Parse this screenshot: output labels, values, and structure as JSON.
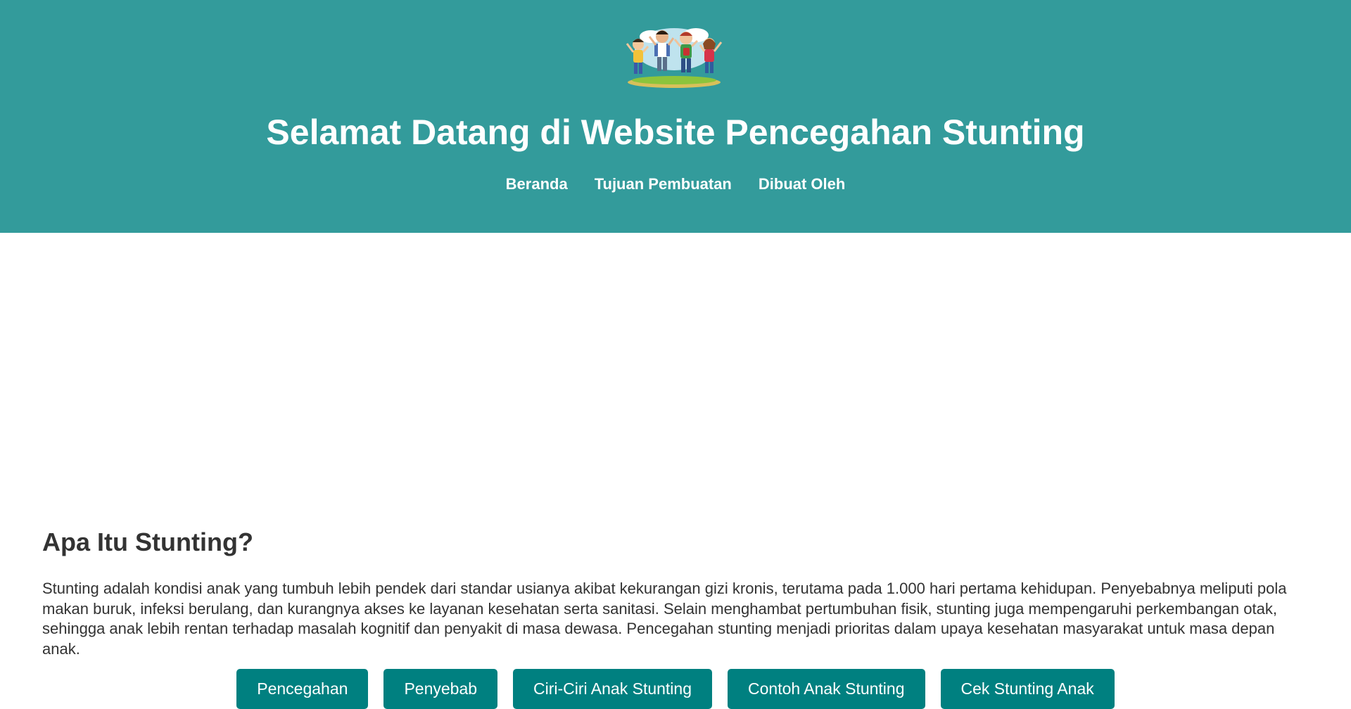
{
  "header": {
    "logo_icon": "jumping-children-illustration",
    "title": "Selamat Datang di Website Pencegahan Stunting",
    "nav": [
      {
        "label": "Beranda"
      },
      {
        "label": "Tujuan Pembuatan"
      },
      {
        "label": "Dibuat Oleh"
      }
    ]
  },
  "main": {
    "heading": "Apa Itu Stunting?",
    "paragraph": "Stunting adalah kondisi anak yang tumbuh lebih pendek dari standar usianya akibat kekurangan gizi kronis, terutama pada 1.000 hari pertama kehidupan. Penyebabnya meliputi pola makan buruk, infeksi berulang, dan kurangnya akses ke layanan kesehatan serta sanitasi. Selain menghambat pertumbuhan fisik, stunting juga mempengaruhi perkembangan otak, sehingga anak lebih rentan terhadap masalah kognitif dan penyakit di masa dewasa. Pencegahan stunting menjadi prioritas dalam upaya kesehatan masyarakat untuk masa depan anak.",
    "buttons": [
      {
        "label": "Pencegahan"
      },
      {
        "label": "Penyebab"
      },
      {
        "label": "Ciri-Ciri Anak Stunting"
      },
      {
        "label": "Contoh Anak Stunting"
      },
      {
        "label": "Cek Stunting Anak"
      }
    ]
  },
  "colors": {
    "header_bg": "#339b9b",
    "button_bg": "#008080",
    "text": "#333333"
  }
}
